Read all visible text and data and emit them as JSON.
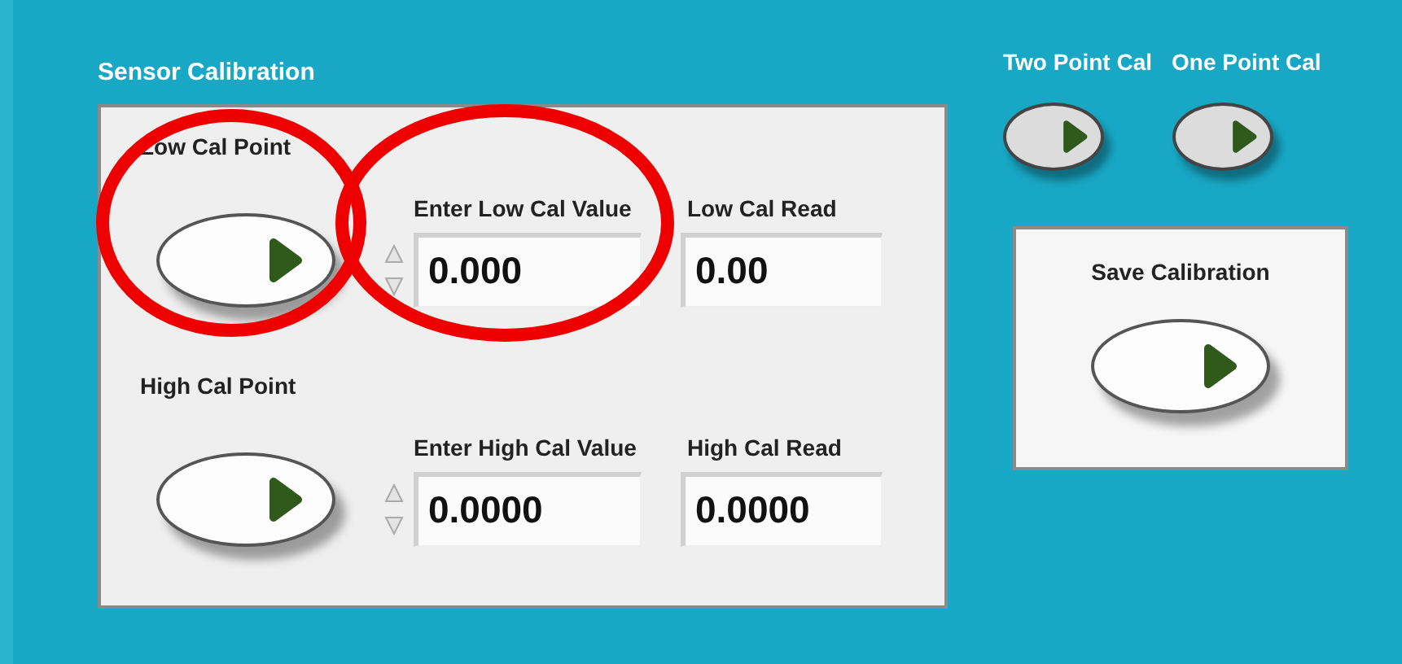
{
  "sensor_calibration": {
    "title": "Sensor Calibration",
    "rows": [
      {
        "point_label": "Low Cal Point",
        "value_label": "Enter Low Cal Value",
        "value": "0.000",
        "read_label": "Low Cal Read",
        "read": "0.00"
      },
      {
        "point_label": "High Cal Point",
        "value_label": "Enter High Cal Value",
        "value": "0.0000",
        "read_label": "High Cal Read",
        "read": "0.0000"
      }
    ]
  },
  "mode_buttons": [
    {
      "label": "Two Point Cal"
    },
    {
      "label": "One Point Cal"
    }
  ],
  "save": {
    "label": "Save Calibration"
  }
}
